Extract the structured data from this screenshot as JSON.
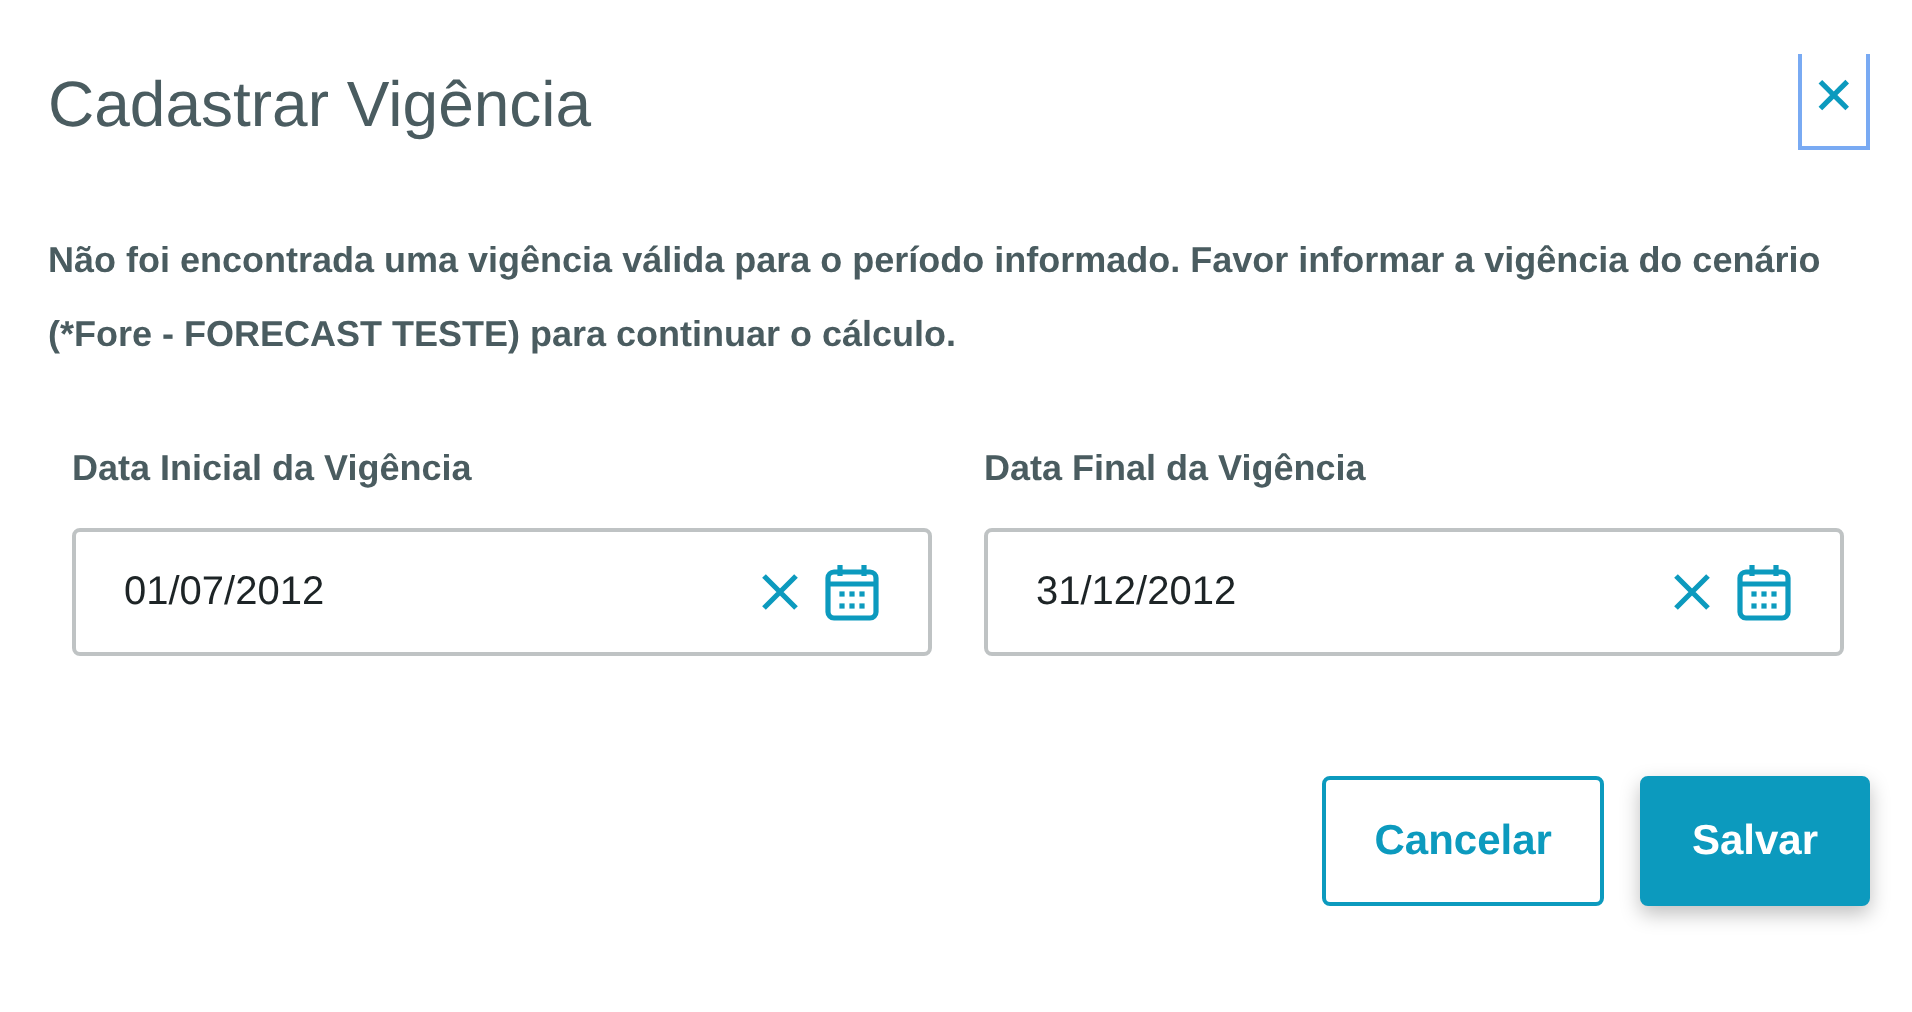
{
  "dialog": {
    "title": "Cadastrar Vigência",
    "close": "✕",
    "message": "Não foi encontrada uma vigência válida para o período informado. Favor informar a vigência do cenário (*Fore - FORECAST TESTE) para continuar o cálculo.",
    "fields": [
      {
        "label": "Data Inicial da Vigência",
        "value": "01/07/2012"
      },
      {
        "label": "Data Final da Vigência",
        "value": "31/12/2012"
      }
    ],
    "buttons": [
      {
        "label": "Cancelar",
        "kind": "secondary"
      },
      {
        "label": "Salvar",
        "kind": "primary"
      }
    ]
  }
}
